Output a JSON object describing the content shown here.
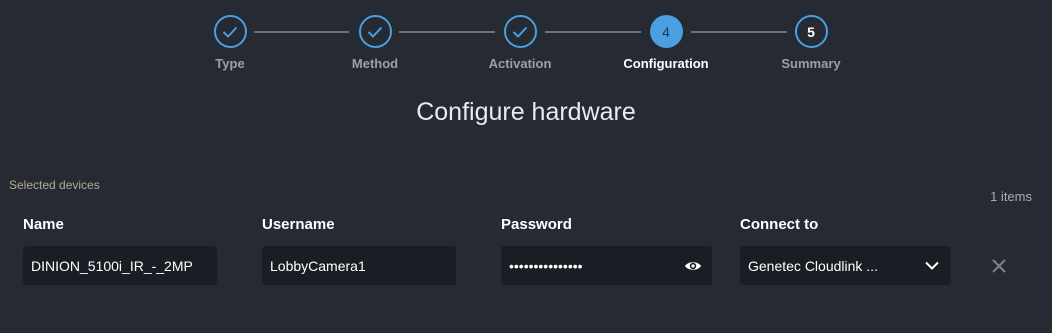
{
  "stepper": {
    "steps": [
      {
        "label": "Type",
        "state": "done",
        "number": ""
      },
      {
        "label": "Method",
        "state": "done",
        "number": ""
      },
      {
        "label": "Activation",
        "state": "done",
        "number": ""
      },
      {
        "label": "Configuration",
        "state": "current",
        "number": "4"
      },
      {
        "label": "Summary",
        "state": "todo",
        "number": "5"
      }
    ]
  },
  "page": {
    "title": "Configure hardware",
    "section_label": "Selected devices",
    "items_count": "1 items"
  },
  "table": {
    "headers": {
      "name": "Name",
      "username": "Username",
      "password": "Password",
      "connect_to": "Connect to"
    },
    "row": {
      "name": "DINION_5100i_IR_-_2MP",
      "username": "LobbyCamera1",
      "password_masked": "•••••••••••••••",
      "connect_to": "Genetec Cloudlink ..."
    }
  },
  "icons": {
    "check": "check-icon",
    "eye": "eye-icon",
    "chevron": "chevron-down-icon",
    "close": "close-icon"
  },
  "colors": {
    "background": "#262a33",
    "accent": "#4a9fe3",
    "field_bg": "#1a1d24"
  }
}
